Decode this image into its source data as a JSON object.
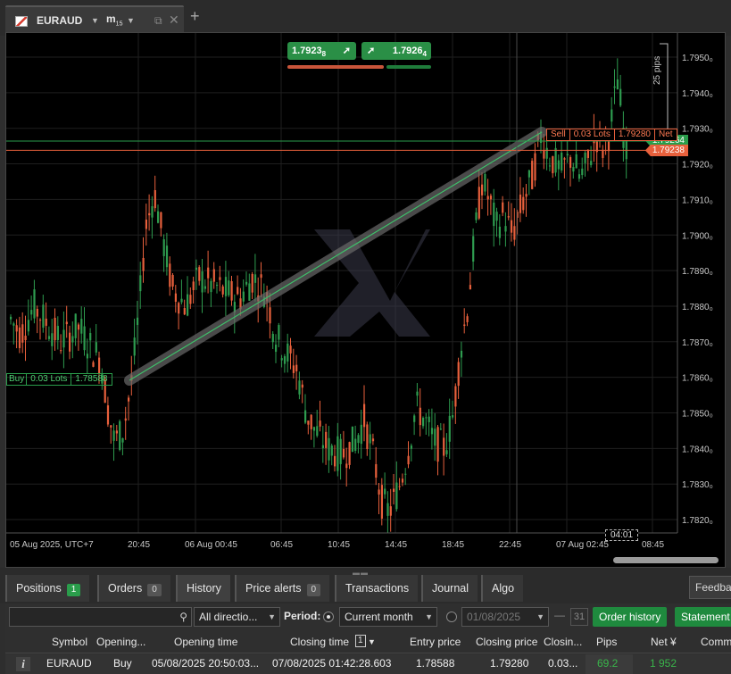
{
  "tab": {
    "symbol": "EURAUD",
    "timeframe": "m",
    "timeframe_sub": "15"
  },
  "chart": {
    "quote_sell": "1.7923",
    "quote_sell_small": "8",
    "quote_buy": "1.7926",
    "quote_buy_small": "4",
    "price_ticks": [
      "1.7950₀",
      "1.7940₀",
      "1.7930₀",
      "1.7920₀",
      "1.7910₀",
      "1.7900₀",
      "1.7890₀",
      "1.7880₀",
      "1.7870₀",
      "1.7860₀",
      "1.7850₀",
      "1.7840₀",
      "1.7830₀",
      "1.7820₀"
    ],
    "time_ticks": [
      "05 Aug 2025, UTC+7",
      "20:45",
      "06 Aug 00:45",
      "06:45",
      "10:45",
      "14:45",
      "18:45",
      "22:45",
      "07 Aug 02:45",
      "08:45"
    ],
    "ask_price": "1.79264",
    "bid_price": "1.79238",
    "countdown": "04:01",
    "pips_label": "25 pips",
    "buy_box": {
      "side": "Buy",
      "lots": "0.03 Lots",
      "price": "1.78588"
    },
    "sell_box": {
      "side": "Sell",
      "lots": "0.03 Lots",
      "price": "1.79280",
      "net": "Net"
    },
    "colors": {
      "up": "#2e9c4f",
      "down": "#e8603c",
      "grid": "#1f1f1f"
    }
  },
  "panel": {
    "tabs": [
      {
        "label": "Positions",
        "badge": "1"
      },
      {
        "label": "Orders",
        "badge": "0"
      },
      {
        "label": "History",
        "badge": ""
      },
      {
        "label": "Price alerts",
        "badge": "0"
      },
      {
        "label": "Transactions",
        "badge": ""
      },
      {
        "label": "Journal",
        "badge": ""
      },
      {
        "label": "Algo",
        "badge": ""
      }
    ],
    "feedback": "Feedba",
    "toolbar": {
      "direction": "All directio...",
      "period_label": "Period:",
      "period_value": "Current month",
      "date": "01/08/2025",
      "date_dash": "—",
      "date_end_icon": "31",
      "order_history": "Order history",
      "statement": "Statement"
    },
    "columns": [
      "Symbol",
      "Opening...",
      "Opening time",
      "Closing time",
      "1",
      "Entry price",
      "Closing price",
      "Closin...",
      "Pips",
      "Net ¥",
      "Comm"
    ],
    "rows": [
      {
        "symbol": "EURAUD",
        "direction": "Buy",
        "opening_time": "05/08/2025 20:50:03...",
        "closing_time": "07/08/2025 01:42:28.603",
        "entry": "1.78588",
        "closing": "1.79280",
        "closing_qty": "0.03...",
        "pips": "69.2",
        "net": "1 952"
      }
    ]
  }
}
